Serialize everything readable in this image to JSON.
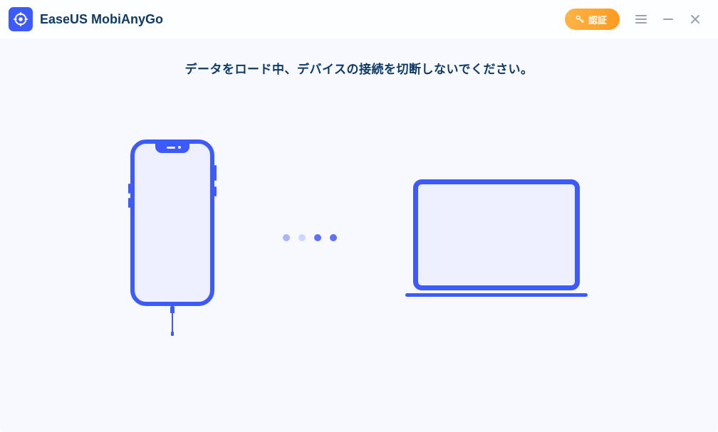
{
  "app": {
    "title": "EaseUS MobiAnyGo"
  },
  "header": {
    "auth_button_label": "認証"
  },
  "status": {
    "message": "データをロード中、デバイスの接続を切断しないでください。"
  }
}
